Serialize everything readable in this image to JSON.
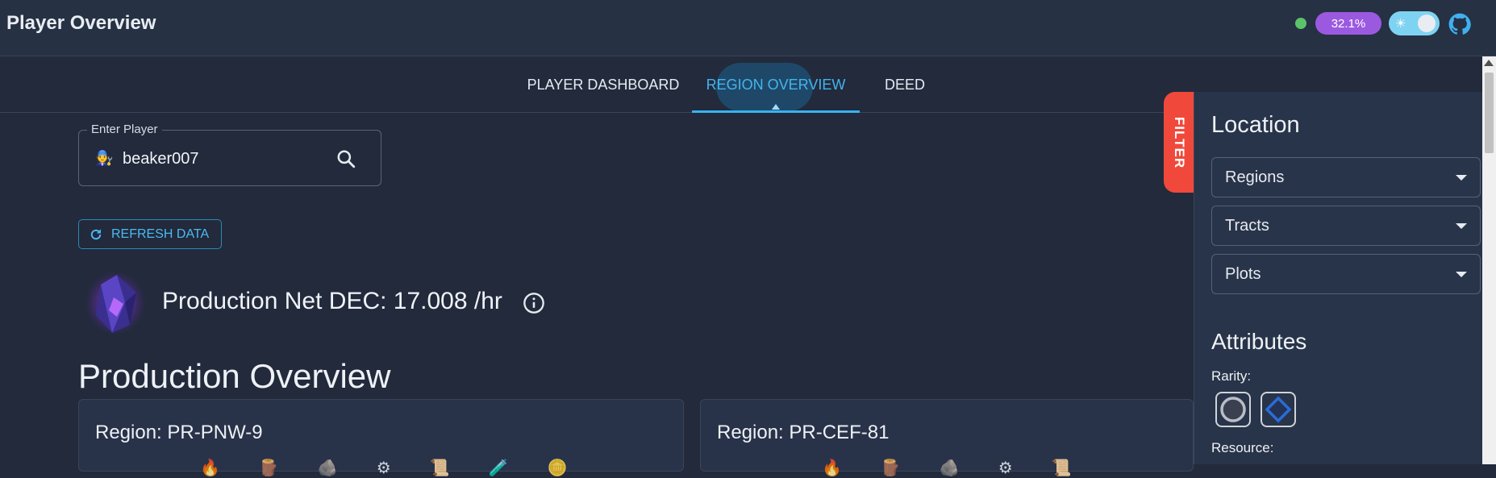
{
  "app": {
    "title": "Player Overview"
  },
  "header": {
    "percent_badge": "32.1%",
    "status_color": "#5bc26a",
    "accent": "#9b59e0"
  },
  "tabs": [
    {
      "label": "PLAYER DASHBOARD"
    },
    {
      "label": "REGION OVERVIEW",
      "active": true
    },
    {
      "label": "DEED"
    }
  ],
  "player_search": {
    "label": "Enter Player",
    "value": "beaker007"
  },
  "refresh": {
    "label": "REFRESH DATA"
  },
  "production": {
    "dec_text": "Production Net DEC: 17.008 /hr",
    "overview_title": "Production Overview"
  },
  "regions": [
    {
      "name": "Region: PR-PNW-9"
    },
    {
      "name": "Region: PR-CEF-81"
    }
  ],
  "filter": {
    "tab_label": "FILTER",
    "location_heading": "Location",
    "selects": [
      "Regions",
      "Tracts",
      "Plots"
    ],
    "attributes_heading": "Attributes",
    "rarity_label": "Rarity:",
    "resource_label": "Resource:"
  }
}
